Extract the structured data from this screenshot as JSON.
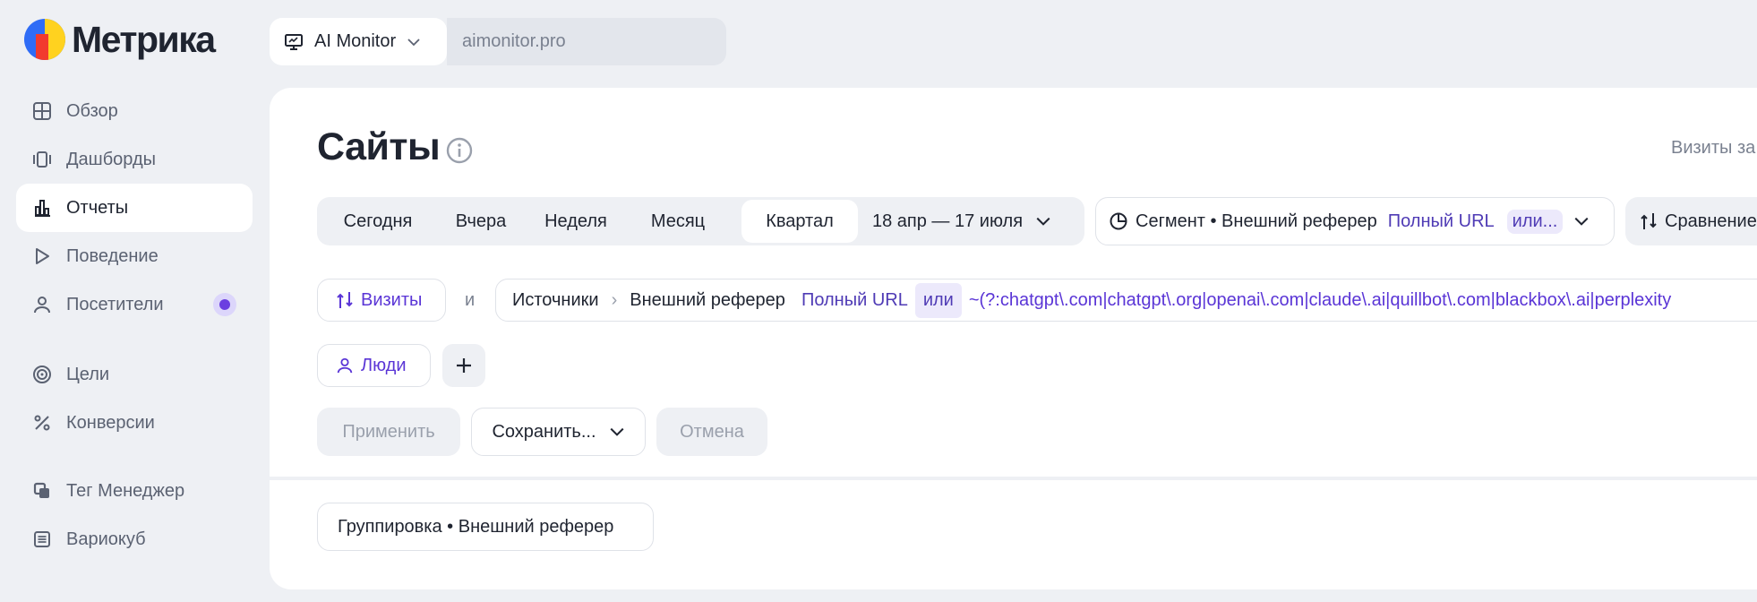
{
  "logo": {
    "text": "Метрика"
  },
  "topbar": {
    "project": "AI Monitor",
    "counter": "aimonitor.pro"
  },
  "sidebar": {
    "items": [
      {
        "label": "Обзор",
        "icon": "grid-icon"
      },
      {
        "label": "Дашборды",
        "icon": "dashboards-icon"
      },
      {
        "label": "Отчеты",
        "icon": "reports-icon",
        "active": true
      },
      {
        "label": "Поведение",
        "icon": "play-icon"
      },
      {
        "label": "Посетители",
        "icon": "user-icon"
      },
      {
        "label": "Цели",
        "icon": "target-icon"
      },
      {
        "label": "Конверсии",
        "icon": "percent-icon"
      },
      {
        "label": "Тег Менеджер",
        "icon": "tag-manager-icon"
      },
      {
        "label": "Вариокуб",
        "icon": "variocube-icon"
      }
    ]
  },
  "main": {
    "title": "Сайты",
    "visits_label": "Визиты за",
    "period": {
      "today": "Сегодня",
      "yesterday": "Вчера",
      "week": "Неделя",
      "month": "Месяц",
      "quarter": "Квартал",
      "range": "18 апр — 17 июля"
    },
    "segment": {
      "prefix": "Сегмент • Внешний реферер",
      "url": "Полный URL",
      "or": "или..."
    },
    "compare": "Сравнение",
    "filter": {
      "visits": "Визиты",
      "and": "и",
      "source": "Источники",
      "referrer": "Внешний реферер",
      "url": "Полный URL",
      "or": "или",
      "regex": "~(?:chatgpt\\.com|chatgpt\\.org|openai\\.com|claude\\.ai|quillbot\\.com|blackbox\\.ai|perplexity",
      "people": "Люди"
    },
    "actions": {
      "apply": "Применить",
      "save": "Сохранить...",
      "cancel": "Отмена"
    },
    "grouping": "Группировка • Внешний реферер"
  },
  "colors": {
    "accent": "#5a35d6",
    "background": "#eef0f4"
  }
}
